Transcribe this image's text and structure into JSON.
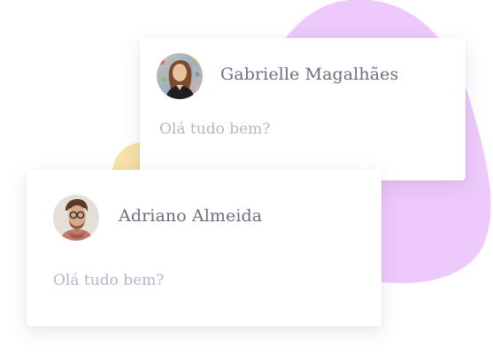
{
  "colors": {
    "blob_purple": "#eec9fb",
    "blob_yellow": "#f8e2a4",
    "name_text": "#6f6c7f",
    "message_text": "#b7b3cc"
  },
  "cards": [
    {
      "name": "Gabrielle Magalhães",
      "message": "Olá tudo bem?",
      "avatar_icon": "woman-avatar"
    },
    {
      "name": "Adriano Almeida",
      "message": "Olá tudo bem?",
      "avatar_icon": "man-with-glasses-avatar"
    }
  ]
}
